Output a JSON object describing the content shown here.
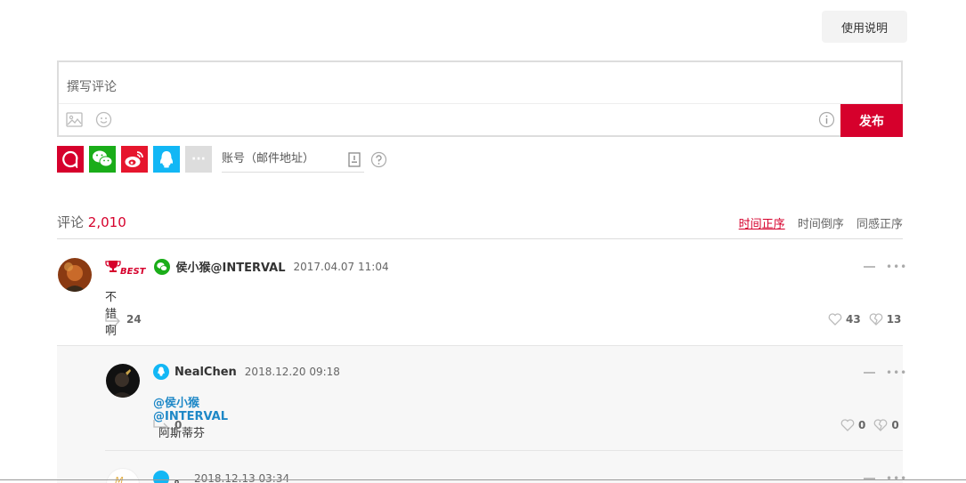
{
  "help_button": "使用说明",
  "editor": {
    "placeholder": "撰写评论",
    "post_label": "发布"
  },
  "login": {
    "account_placeholder": "账号（邮件地址）",
    "more_label": "···",
    "colors": {
      "netease": "#d6002c",
      "wechat": "#1aad19",
      "weibo": "#e6162d",
      "qq": "#12b7f5",
      "more": "#dddddd"
    }
  },
  "comments_header": {
    "label": "评论",
    "count": "2,010",
    "sort_tabs": [
      "时间正序",
      "时间倒序",
      "同感正序"
    ]
  },
  "comments": [
    {
      "badge": "BEST",
      "source_icon": "wechat-icon",
      "username": "侯小猴@INTERVAL",
      "time": "2017.04.07 11:04",
      "text": "不错啊",
      "replies": "24",
      "likes": "43",
      "dislikes": "13"
    },
    {
      "source_icon": "qq-icon",
      "username": "NealChen",
      "time": "2018.12.20 09:18",
      "mention": "@侯小猴@INTERVAL",
      "text": "阿斯蒂芬",
      "replies": "0",
      "likes": "0",
      "dislikes": "0"
    },
    {
      "source_icon": "qq-icon",
      "username": "。",
      "time": "2018.12.13 03:34"
    }
  ],
  "accent_color": "#d6002c"
}
